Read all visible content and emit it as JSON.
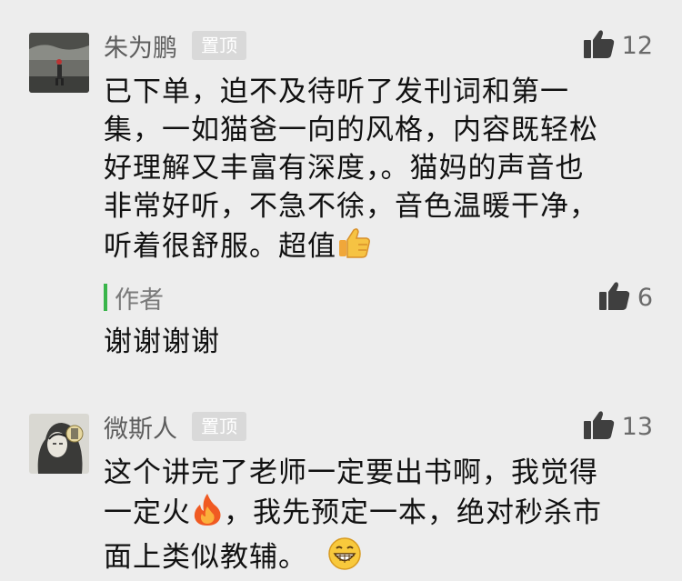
{
  "comments": [
    {
      "author": "朱为鹏",
      "badge": "置顶",
      "likes": "12",
      "lines": [
        "已下单，迫不及待听了发刊词和第一",
        "集，一如猫爸一向的风格，内容既轻松",
        "好理解又丰富有深度，。猫妈的声音也",
        "非常好听，不急不徐，音色温暖干净，",
        "听着很舒服。超值"
      ],
      "trailing_emoji": "thumbs-up-emoji",
      "reply": {
        "label": "作者",
        "likes": "6",
        "text": "谢谢谢谢"
      }
    },
    {
      "author": "微斯人",
      "badge": "置顶",
      "likes": "13",
      "lines": [
        "这个讲完了老师一定要出书啊，我觉得",
        "一定火",
        "，我先预定一本，绝对秒杀市",
        "面上类似教辅。"
      ],
      "inline_emojis": [
        "fire-emoji",
        "grinning-emoji"
      ]
    }
  ],
  "colors": {
    "background": "#ededed",
    "author_name": "#5d5d5d",
    "badge_bg": "#d9d9d9",
    "thumb_icon": "#3f3f3f",
    "reply_bar": "#39b54a"
  }
}
